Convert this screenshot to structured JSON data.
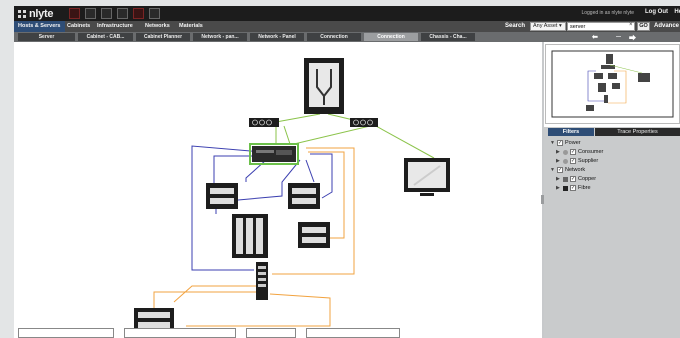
{
  "app": {
    "logo_text": "nlyte",
    "user_text": "Logged in as nlyte  nlyte",
    "logout_label": "Log Out",
    "help_label": "He"
  },
  "nav": {
    "items": [
      "Hosts & Servers",
      "Cabinets",
      "Infrastructure",
      "Networks",
      "Materials"
    ],
    "active_index": 0
  },
  "search": {
    "label": "Search",
    "asset_filter": "Any Asset ▾",
    "value": "server",
    "clear_label": "×",
    "go_label": "GO",
    "advanced_label": "Advance"
  },
  "tabs": {
    "items": [
      "Server",
      "Cabinet - CAB...",
      "Cabinet Planner",
      "Network - pan...",
      "Network - Panel",
      "Connection",
      "Connection",
      "Chassis - Cha..."
    ],
    "active_index": 6
  },
  "nav_arrows": {
    "left": "⬅",
    "right": "⮕"
  },
  "panel": {
    "tab_filters": "Filters",
    "tab_trace": "Trace Properties",
    "tree": [
      {
        "label": "Power",
        "level": 0,
        "expanded": true,
        "checked": true,
        "icon": "none"
      },
      {
        "label": "Consumer",
        "level": 1,
        "expanded": false,
        "checked": true,
        "icon": "round-gray"
      },
      {
        "label": "Supplier",
        "level": 1,
        "expanded": false,
        "checked": true,
        "icon": "round-gray"
      },
      {
        "label": "Network",
        "level": 0,
        "expanded": true,
        "checked": true,
        "icon": "none"
      },
      {
        "label": "Copper",
        "level": 1,
        "expanded": false,
        "checked": true,
        "icon": "square-gray"
      },
      {
        "label": "Fibre",
        "level": 1,
        "expanded": false,
        "checked": true,
        "icon": "square-dark"
      }
    ]
  },
  "colors": {
    "topbar": "#1c1c1c",
    "nav_active": "#2e4d76",
    "link_green": "#8bc34a",
    "link_blue": "#3b3fb0",
    "link_orange": "#f2a340",
    "highlight": "#6cc04a"
  }
}
